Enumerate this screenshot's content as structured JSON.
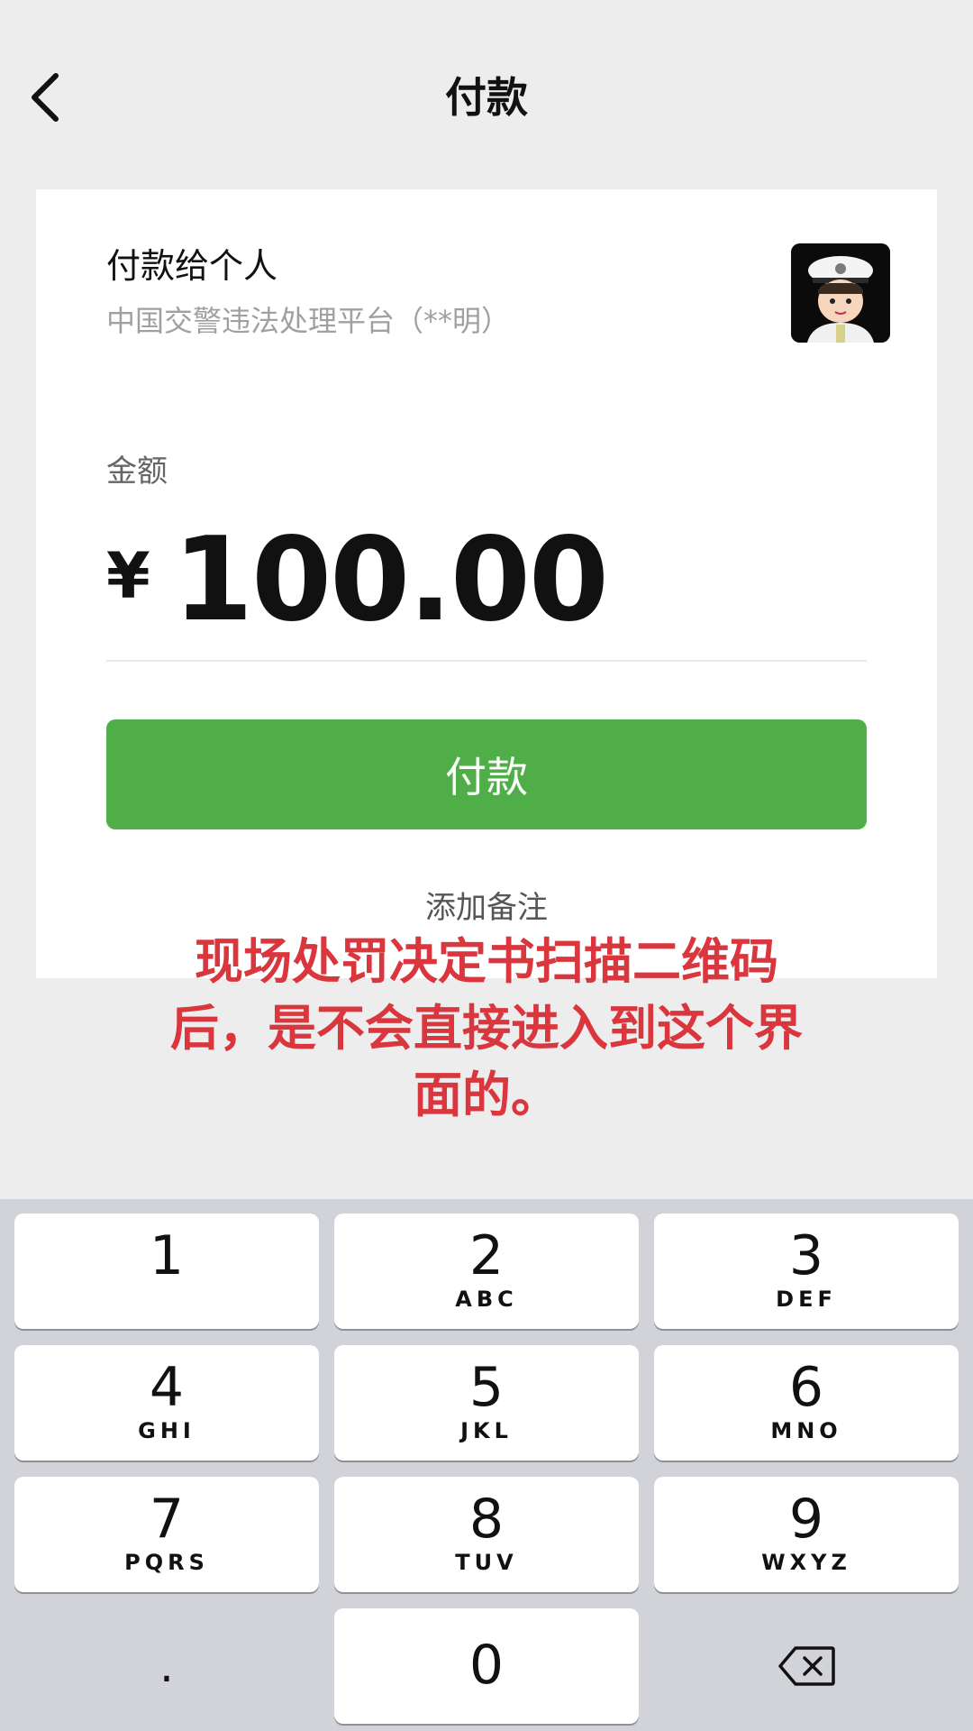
{
  "nav": {
    "title": "付款"
  },
  "payee": {
    "title": "付款给个人",
    "name": "中国交警违法处理平台（**明）"
  },
  "amount": {
    "label": "金额",
    "currency": "¥",
    "value": "100.00"
  },
  "pay_button": {
    "label": "付款"
  },
  "add_note": "添加备注",
  "warning": {
    "line1": "现场处罚决定书扫描二维码",
    "line2": "后，是不会直接进入到这个界",
    "line3": "面的。",
    "color": "#d9363e"
  },
  "keypad": {
    "keys": [
      {
        "num": "1",
        "letters": ""
      },
      {
        "num": "2",
        "letters": "ABC"
      },
      {
        "num": "3",
        "letters": "DEF"
      },
      {
        "num": "4",
        "letters": "GHI"
      },
      {
        "num": "5",
        "letters": "JKL"
      },
      {
        "num": "6",
        "letters": "MNO"
      },
      {
        "num": "7",
        "letters": "PQRS"
      },
      {
        "num": "8",
        "letters": "TUV"
      },
      {
        "num": "9",
        "letters": "WXYZ"
      },
      {
        "num": "0",
        "letters": ""
      }
    ],
    "dot": ".",
    "delete_icon": "backspace-icon"
  },
  "colors": {
    "accent": "#4fae48",
    "background": "#ededed",
    "keyboard": "#d1d3d9"
  }
}
